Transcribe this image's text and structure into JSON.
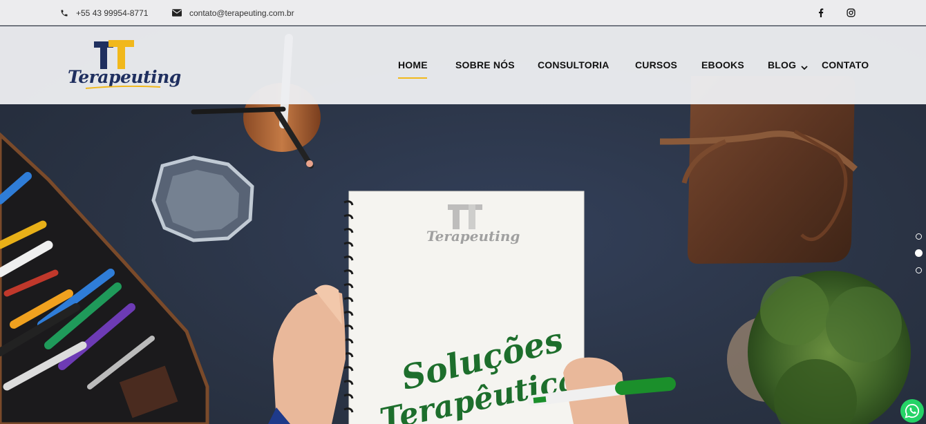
{
  "topbar": {
    "phone": "+55 43 99954-8771",
    "email": "contato@terapeuting.com.br",
    "phone_icon": "phone-icon",
    "email_icon": "envelope-icon",
    "social": [
      "facebook-icon",
      "instagram-icon"
    ]
  },
  "brand": {
    "name": "Terapeuting",
    "logo_colors": {
      "primary": "#1f2f5f",
      "accent": "#f1b81b"
    }
  },
  "nav": {
    "items": [
      {
        "label": "HOME",
        "active": true
      },
      {
        "label": "SOBRE NÓS"
      },
      {
        "label": "CONSULTORIA"
      },
      {
        "label": "CURSOS"
      },
      {
        "label": "EBOOKS"
      },
      {
        "label": "BLOG",
        "has_dropdown": true
      },
      {
        "label": "CONTATO"
      }
    ],
    "active_color": "#f1b81b"
  },
  "hero": {
    "notebook_logo": "Terapeuting",
    "handwriting_line1": "Soluções",
    "handwriting_line2": "Terapêuticas",
    "handwriting_color": "#1d6e2c",
    "slider": {
      "total": 3,
      "active": 2
    }
  },
  "floating": {
    "whatsapp_icon": "whatsapp-icon"
  }
}
